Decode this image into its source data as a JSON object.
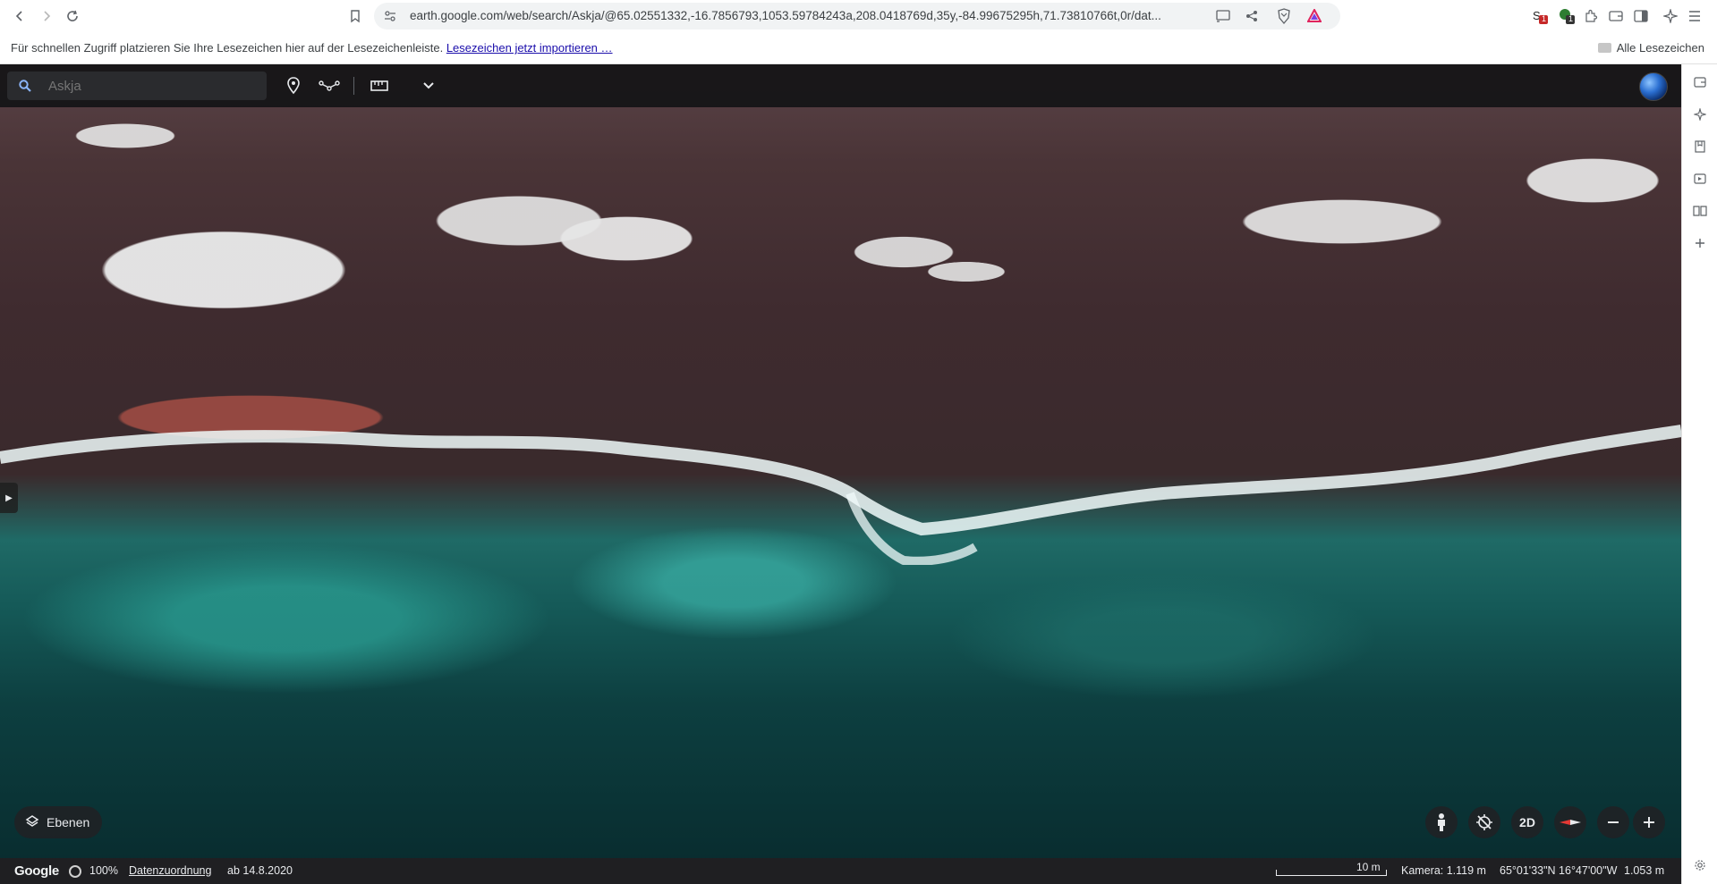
{
  "browser": {
    "url": "earth.google.com/web/search/Askja/@65.02551332,-16.7856793,1053.59784243a,208.0418769d,35y,-84.99675295h,71.73810766t,0r/dat...",
    "bookmarks_hint": "Für schnellen Zugriff platzieren Sie Ihre Lesezeichen hier auf der Lesezeichenleiste.",
    "bookmarks_import_link": "Lesezeichen jetzt importieren …",
    "all_bookmarks": "Alle Lesezeichen",
    "extension_badges": [
      "1",
      "1"
    ]
  },
  "earth": {
    "search_placeholder": "Askja",
    "layers_label": "Ebenen",
    "view_2d_label": "2D",
    "status": {
      "logo": "Google",
      "load_percent": "100%",
      "attribution": "Datenzuordnung",
      "imagery_date": "ab 14.8.2020",
      "scale": "10 m",
      "camera": "Kamera: 1.119 m",
      "coordinates": "65°01'33\"N 16°47'00\"W",
      "elevation": "1.053 m"
    },
    "colors": {
      "toolbar_bg": "#141416",
      "status_bg": "#1f1f22",
      "accent_link": "#1a0dab"
    }
  }
}
